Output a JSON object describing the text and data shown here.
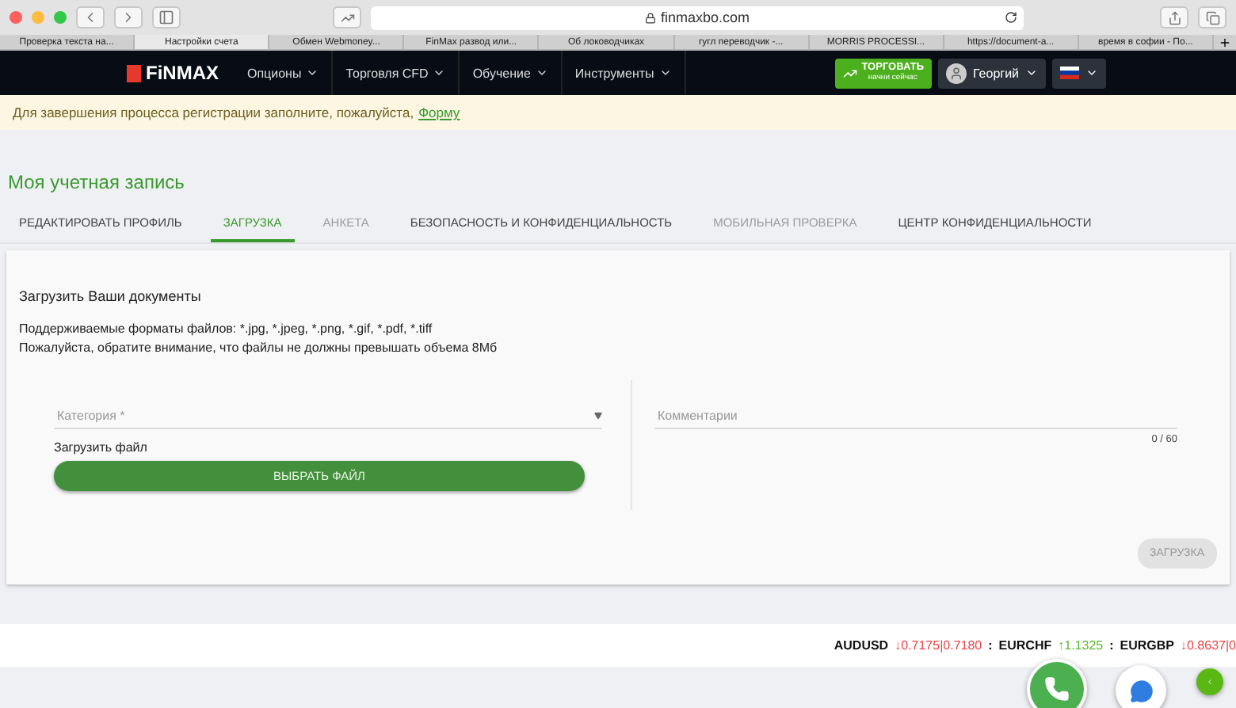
{
  "browser": {
    "url": "finmaxbo.com",
    "tabs": [
      {
        "label": "Проверка текста на...",
        "selected": false
      },
      {
        "label": "Настройки счета",
        "selected": true
      },
      {
        "label": "Обмен Webmoney...",
        "selected": false
      },
      {
        "label": "FinMax развод или...",
        "selected": false
      },
      {
        "label": "Об лоководчиках",
        "selected": false
      },
      {
        "label": "гугл переводчик -...",
        "selected": false
      },
      {
        "label": "MORRIS PROCESSI...",
        "selected": false
      },
      {
        "label": "https://document-a...",
        "selected": false
      },
      {
        "label": "время в софии - По...",
        "selected": false
      }
    ]
  },
  "nav": {
    "logo": "FiNMAX",
    "menu": [
      "Опционы",
      "Торговля CFD",
      "Обучение",
      "Инструменты"
    ],
    "trade_button": {
      "label": "ТОРГОВАТЬ",
      "sublabel": "начни сейчас"
    },
    "user": "Георгий"
  },
  "notice": {
    "text": "Для завершения процесса регистрации заполните, пожалуйста,",
    "link": "Форму"
  },
  "page_title": "Моя учетная запись",
  "tabs": [
    {
      "label": "РЕДАКТИРОВАТЬ ПРОФИЛЬ",
      "selected": false,
      "disabled": false
    },
    {
      "label": "ЗАГРУЗКА",
      "selected": true,
      "disabled": false
    },
    {
      "label": "АНКЕТА",
      "selected": false,
      "disabled": true
    },
    {
      "label": "БЕЗОПАСНОСТЬ И КОНФИДЕНЦИАЛЬНОСТЬ",
      "selected": false,
      "disabled": false
    },
    {
      "label": "МОБИЛЬНАЯ ПРОВЕРКА",
      "selected": false,
      "disabled": true
    },
    {
      "label": "ЦЕНТР КОНФИДЕНЦИАЛЬНОСТИ",
      "selected": false,
      "disabled": false
    }
  ],
  "upload": {
    "heading": "Загрузить Ваши документы",
    "notes": [
      "Поддерживаемые форматы файлов: *.jpg, *.jpeg, *.png, *.gif, *.pdf, *.tiff",
      "Пожалуйста, обратите внимание, что файлы не должны превышать объема 8Мб"
    ],
    "category": {
      "placeholder": "Категория *"
    },
    "file_label": "Загрузить файл",
    "choose_button": "ВЫБРАТЬ ФАЙЛ",
    "comment": {
      "placeholder": "Комментарии",
      "counter": "0 / 60"
    },
    "submit": {
      "label": "ЗАГРУЗКА",
      "disabled": true
    }
  },
  "ticker": [
    {
      "symbol": "AUDUSD",
      "rising": false,
      "value": "↓0.7175|0.7180"
    },
    {
      "separator": ":",
      "symbol": "EURCHF",
      "rising": true,
      "value": "↑1.1325"
    },
    {
      "separator": ":",
      "symbol": "EURGBP",
      "rising": false,
      "value": "↓0.8637|0"
    }
  ]
}
